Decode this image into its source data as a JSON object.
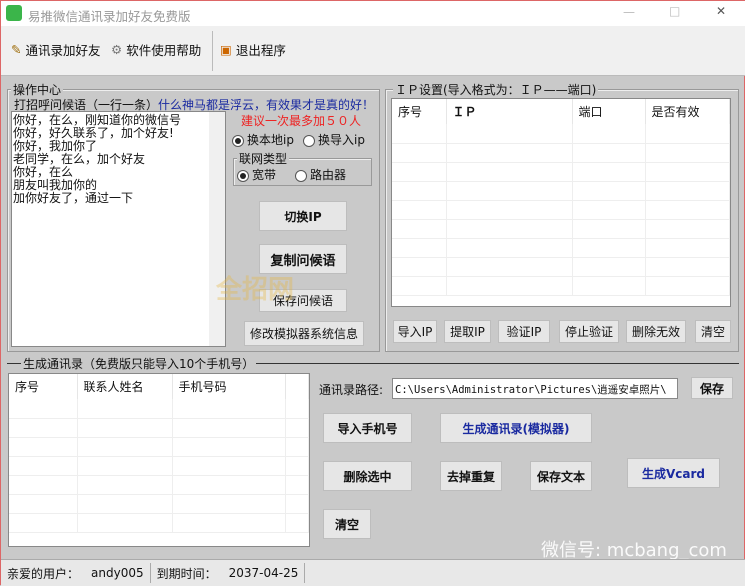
{
  "window": {
    "title": "易推微信通讯录加好友免费版",
    "minimize": "—",
    "maximize": "□",
    "close": "✕"
  },
  "toolbar": {
    "items": [
      {
        "label": "通讯录加好友",
        "icon": "address-book-icon"
      },
      {
        "label": "软件使用帮助",
        "icon": "gear-icon"
      },
      {
        "label": "退出程序",
        "icon": "exit-icon"
      }
    ]
  },
  "ops": {
    "group_title": "操作中心",
    "greeting_label": "打招呼问候语（一行一条）",
    "slogan": "什么神马都是浮云，有效果才是真的好！",
    "greetings": "你好，在么，刚知道你的微信号\n你好，好久联系了，加个好友!\n你好，我加你了\n老同学，在么，加个好友\n你好，在么\n朋友叫我加你的\n加你好友了，通过一下",
    "suggestion": "建议一次最多加５０人",
    "radio_local": "换本地ip",
    "radio_import": "换导入ip",
    "net_type_title": "联网类型",
    "radio_broadband": "宽带",
    "radio_router": "路由器",
    "btn_switch_ip": "切换IP",
    "btn_copy": "复制问候语",
    "btn_save": "保存问候语",
    "btn_modify": "修改模拟器系统信息"
  },
  "ip": {
    "group_title": "ＩＰ设置(导入格式为：ＩＰ——端口)",
    "columns": [
      "序号",
      "ＩＰ",
      "端口",
      "是否有效"
    ],
    "buttons": [
      "导入IP",
      "提取IP",
      "验证IP",
      "停止验证",
      "删除无效",
      "清空"
    ]
  },
  "contacts": {
    "group_title": "生成通讯录（免费版只能导入10个手机号）",
    "columns": [
      "序号",
      "联系人姓名",
      "手机号码"
    ],
    "path_label": "通讯录路径:",
    "path_value": "C:\\Users\\Administrator\\Pictures\\逍遥安卓照片\\",
    "save": "保存",
    "btn_import": "导入手机号",
    "btn_generate": "生成通讯录(模拟器)",
    "btn_delete": "删除选中",
    "btn_dedupe": "去掉重复",
    "btn_save_text": "保存文本",
    "btn_vcard": "生成Vcard",
    "btn_clear": "清空"
  },
  "status": {
    "user_label": "亲爱的用户：",
    "user": "andy005",
    "expire_label": "到期时间：",
    "expire": "2037-04-25"
  },
  "watermarks": {
    "site": "全招网",
    "wechat": "微信号: mcbang_com"
  }
}
